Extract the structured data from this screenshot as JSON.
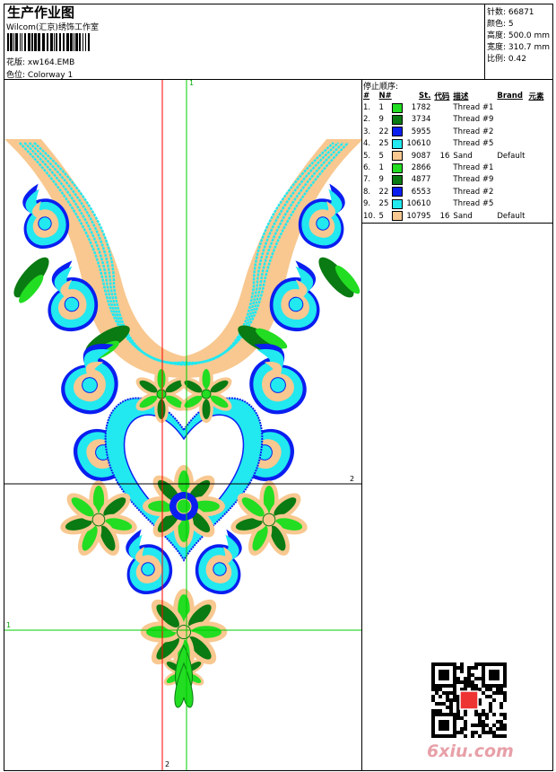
{
  "header": {
    "title": "生产作业图",
    "studio": "Wilcom(汇京)绣饰工作室",
    "design_label": "花版:",
    "design_file": "xw164.EMB",
    "colorway_label": "色位:",
    "colorway": "Colorway 1"
  },
  "info": {
    "stitches": "针数: 66871",
    "colors": "颜色: 5",
    "height": "高度: 500.0 mm",
    "width": "宽度: 310.7 mm",
    "scale": "比例: 0.42"
  },
  "stop_sequence": {
    "title": "停止顺序:",
    "columns": [
      "#",
      "N#",
      "St.",
      "代码",
      "描述",
      "Brand",
      "元素"
    ],
    "rows": [
      {
        "idx": "1.",
        "n": "1",
        "color": "#22dd22",
        "st": "1782",
        "code": "",
        "desc": "Thread #1",
        "brand": ""
      },
      {
        "idx": "2.",
        "n": "9",
        "color": "#0a7a12",
        "st": "3734",
        "code": "",
        "desc": "Thread #9",
        "brand": ""
      },
      {
        "idx": "3.",
        "n": "22",
        "color": "#0a1ef0",
        "st": "5955",
        "code": "",
        "desc": "Thread #2",
        "brand": ""
      },
      {
        "idx": "4.",
        "n": "25",
        "color": "#22e8f0",
        "st": "10610",
        "code": "",
        "desc": "Thread #5",
        "brand": ""
      },
      {
        "idx": "5.",
        "n": "5",
        "color": "#f8c890",
        "st": "9087",
        "code": "16",
        "desc": "Sand",
        "brand": "Default"
      },
      {
        "idx": "6.",
        "n": "1",
        "color": "#22dd22",
        "st": "2866",
        "code": "",
        "desc": "Thread #1",
        "brand": ""
      },
      {
        "idx": "7.",
        "n": "9",
        "color": "#0a7a12",
        "st": "4877",
        "code": "",
        "desc": "Thread #9",
        "brand": ""
      },
      {
        "idx": "8.",
        "n": "22",
        "color": "#0a1ef0",
        "st": "6553",
        "code": "",
        "desc": "Thread #2",
        "brand": ""
      },
      {
        "idx": "9.",
        "n": "25",
        "color": "#22e8f0",
        "st": "10610",
        "code": "",
        "desc": "Thread #5",
        "brand": ""
      },
      {
        "idx": "10.",
        "n": "5",
        "color": "#f8c890",
        "st": "10795",
        "code": "16",
        "desc": "Sand",
        "brand": "Default"
      }
    ]
  },
  "guides": {
    "top": "1",
    "right": "2",
    "left": "1",
    "bottom": "2"
  },
  "watermark": "6xiu.com"
}
